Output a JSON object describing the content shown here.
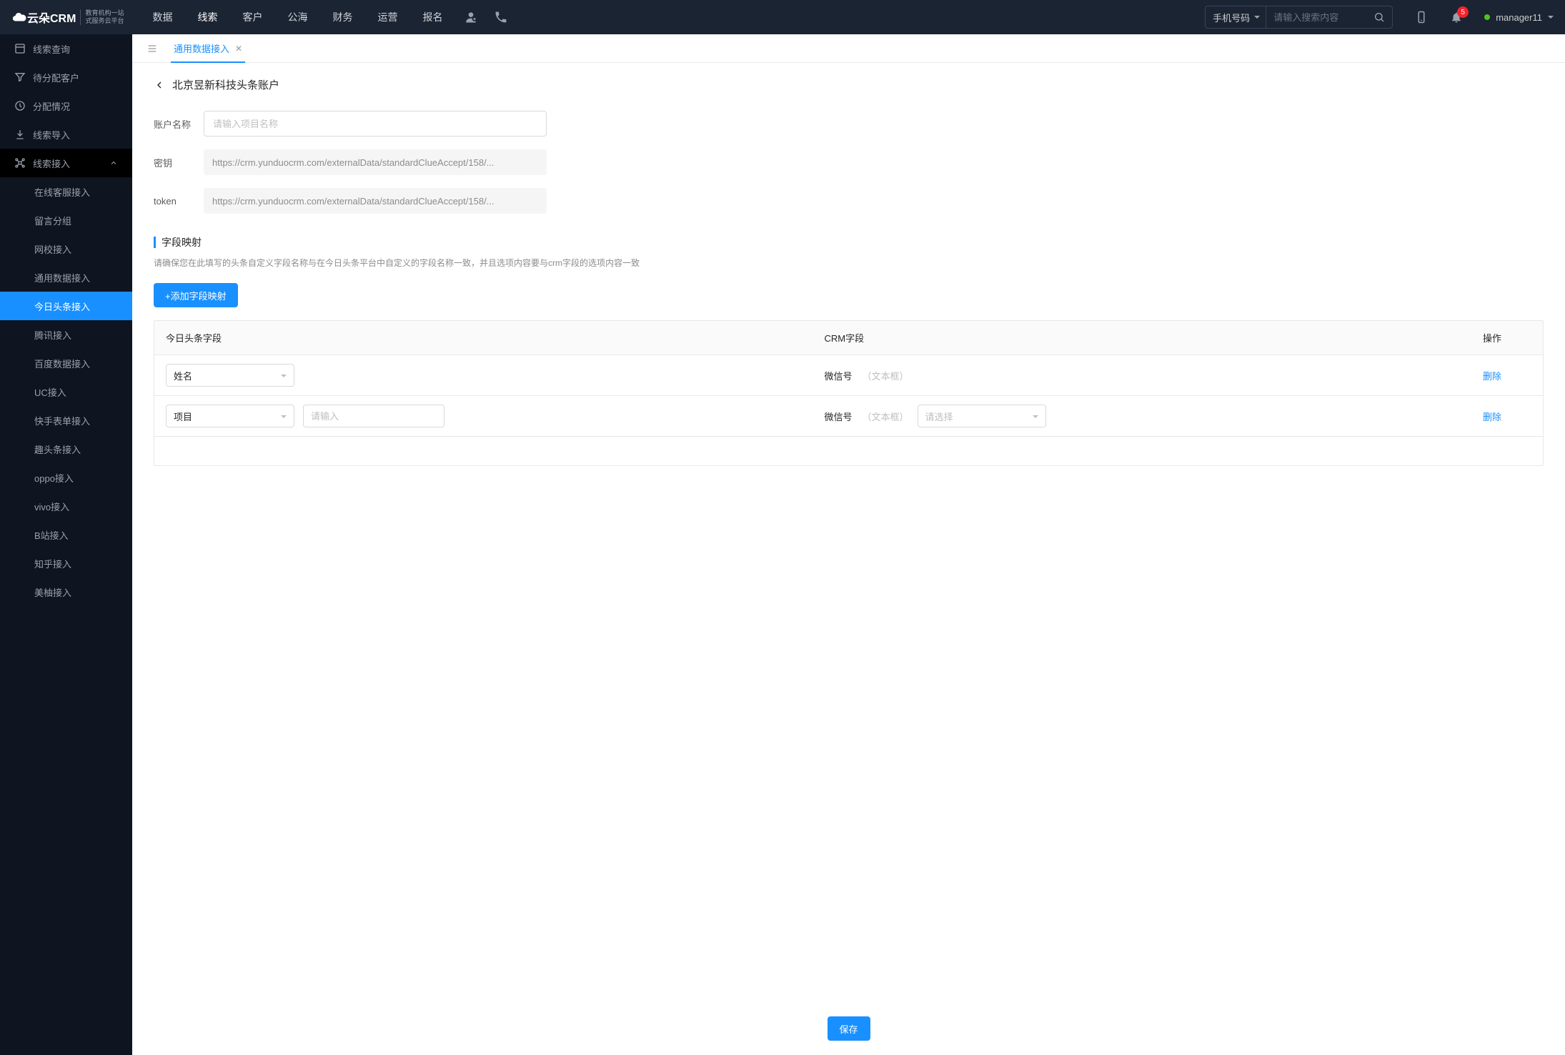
{
  "logo": {
    "main": "云朵CRM",
    "sub1": "教育机构一站",
    "sub2": "式服务云平台"
  },
  "nav": [
    "数据",
    "线索",
    "客户",
    "公海",
    "财务",
    "运营",
    "报名"
  ],
  "nav_active": 1,
  "search": {
    "select": "手机号码",
    "placeholder": "请输入搜索内容"
  },
  "badge": "5",
  "username": "manager11",
  "sidebar": [
    {
      "label": "线索查询"
    },
    {
      "label": "待分配客户"
    },
    {
      "label": "分配情况"
    },
    {
      "label": "线索导入"
    },
    {
      "label": "线索接入",
      "expanded": true,
      "children": [
        "在线客服接入",
        "留言分组",
        "网校接入",
        "通用数据接入",
        "今日头条接入",
        "腾讯接入",
        "百度数据接入",
        "UC接入",
        "快手表单接入",
        "趣头条接入",
        "oppo接入",
        "vivo接入",
        "B站接入",
        "知乎接入",
        "美柚接入"
      ],
      "active_child": 4
    }
  ],
  "tab": {
    "label": "通用数据接入"
  },
  "page": {
    "title": "北京昱新科技头条账户",
    "account_name_label": "账户名称",
    "account_name_placeholder": "请输入项目名称",
    "secret_label": "密钥",
    "secret_value": "https://crm.yunduocrm.com/externalData/standardClueAccept/158/...",
    "token_label": "token",
    "token_value": "https://crm.yunduocrm.com/externalData/standardClueAccept/158/..."
  },
  "mapping": {
    "title": "字段映射",
    "desc": "请确保您在此填写的头条自定义字段名称与在今日头条平台中自定义的字段名称一致，并且选项内容要与crm字段的选项内容一致",
    "add_btn": "+添加字段映射",
    "columns": {
      "field": "今日头条字段",
      "crm": "CRM字段",
      "op": "操作"
    },
    "rows": [
      {
        "select_value": "姓名",
        "crm_label": "微信号",
        "crm_hint": "（文本框）",
        "delete": "删除"
      },
      {
        "select_value": "项目",
        "input_placeholder": "请输入",
        "crm_label": "微信号",
        "crm_hint": "（文本框）",
        "crm_select_placeholder": "请选择",
        "delete": "删除"
      }
    ]
  },
  "save_btn": "保存"
}
